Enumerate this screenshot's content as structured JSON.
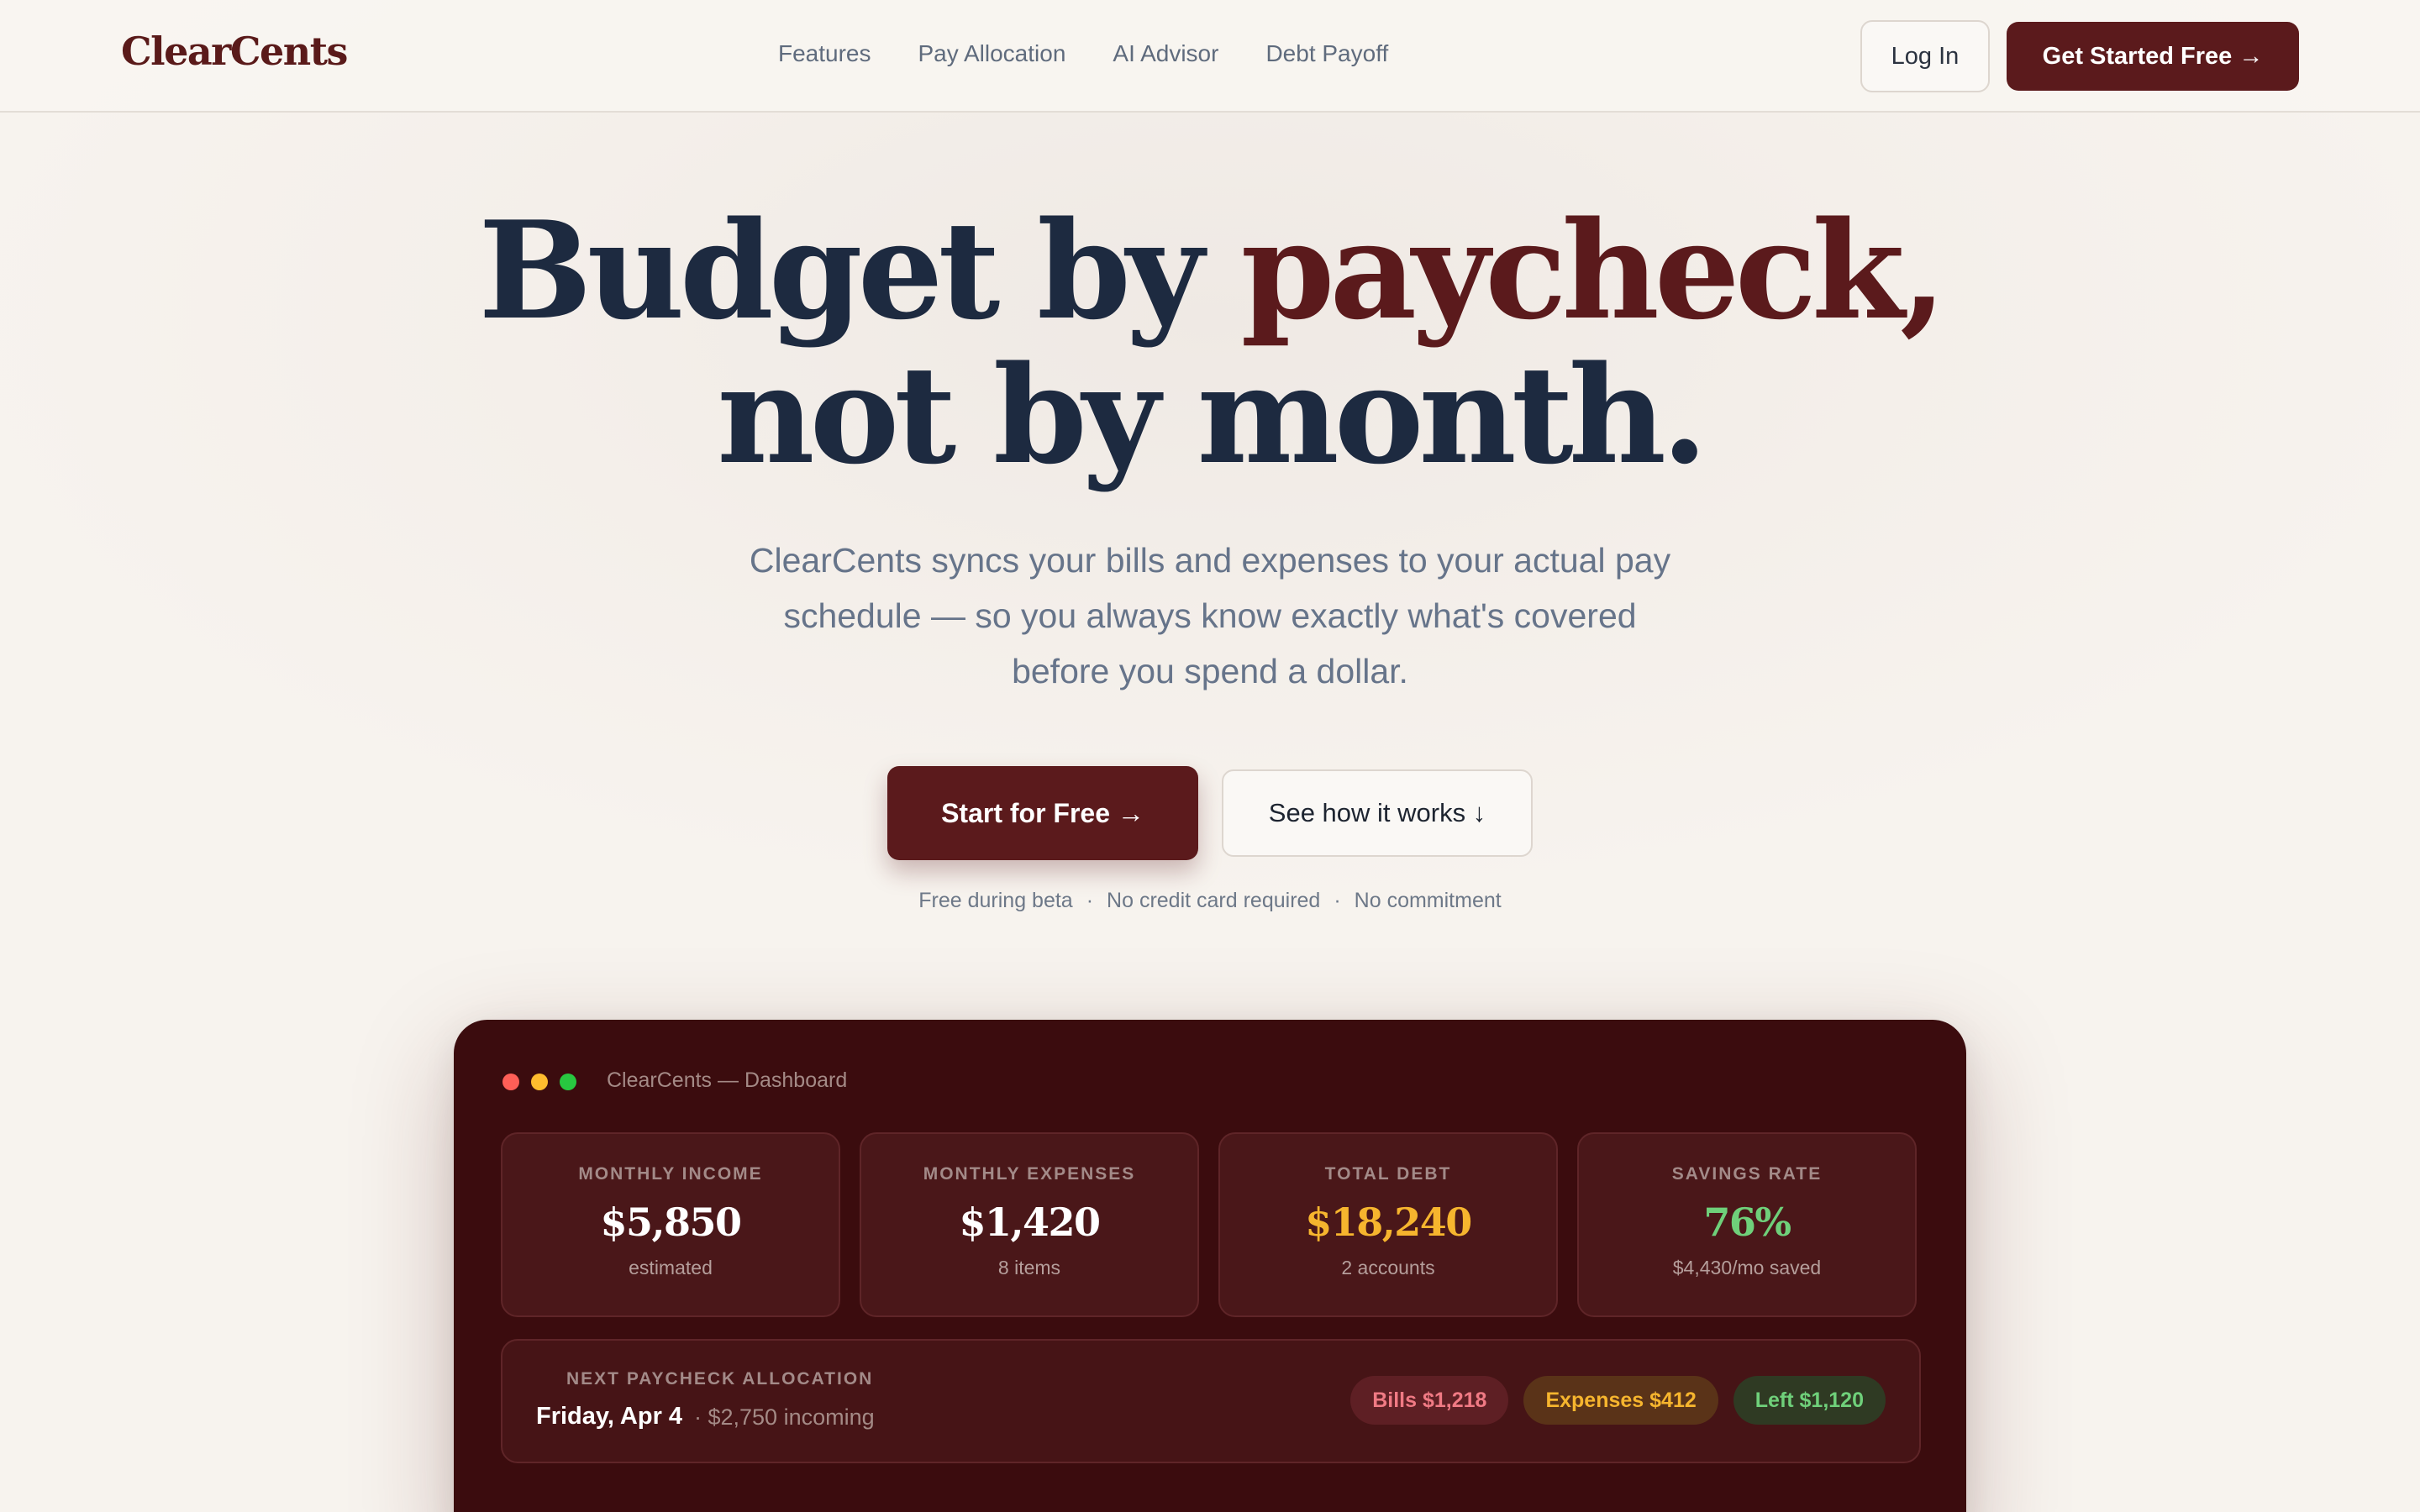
{
  "nav": {
    "logo": "ClearCents",
    "links": [
      "Features",
      "Pay Allocation",
      "AI Advisor",
      "Debt Payoff"
    ],
    "login": "Log In",
    "cta": "Get Started Free →"
  },
  "hero": {
    "title_part1": "Budget by ",
    "title_accent": "paycheck,",
    "title_line2": "not by month.",
    "subtitle": "ClearCents syncs your bills and expenses to your actual pay schedule — so you always know exactly what's covered before you spend a dollar.",
    "cta_primary": "Start for Free →",
    "cta_secondary": "See how it works ↓",
    "fineprint": [
      "Free during beta",
      "No credit card required",
      "No commitment"
    ],
    "fineprint_sep": "·"
  },
  "dashboard": {
    "window_title": "ClearCents — Dashboard",
    "window_dots": [
      "#ff5f57",
      "#febc2e",
      "#28c840"
    ],
    "cards": [
      {
        "label": "MONTHLY INCOME",
        "value": "$5,850",
        "note": "estimated",
        "color": "#ffffff"
      },
      {
        "label": "MONTHLY EXPENSES",
        "value": "$1,420",
        "note": "8 items",
        "color": "#ffffff"
      },
      {
        "label": "TOTAL DEBT",
        "value": "$18,240",
        "note": "2 accounts",
        "color": "#f6b52e"
      },
      {
        "label": "SAVINGS RATE",
        "value": "76%",
        "note": "$4,430/mo saved",
        "color": "#6fd07a"
      }
    ],
    "allocation": {
      "label": "NEXT PAYCHECK ALLOCATION",
      "date": "Friday, Apr 4",
      "income": "· $2,750 incoming",
      "pills": {
        "bills": "Bills $1,218",
        "expenses": "Expenses $412",
        "left": "Left $1,120"
      }
    }
  },
  "colors": {
    "brand": "#5b1a1c",
    "heading": "#1d2a40",
    "dashboard_bg": "#3b0c0e"
  }
}
